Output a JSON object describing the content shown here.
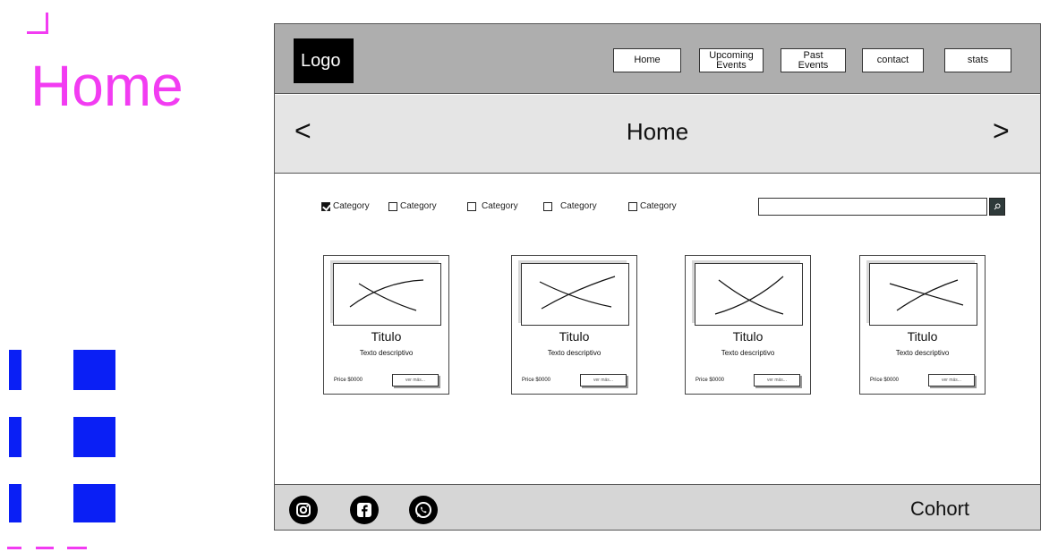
{
  "slide": {
    "title": "Home"
  },
  "colors": {
    "accent_pink": "#f23cf2",
    "accent_blue": "#0a1ff5",
    "header_gray": "#aeaeae",
    "hero_gray": "#e5e5e5",
    "footer_gray": "#d6d6d6"
  },
  "header": {
    "logo": "Logo",
    "nav": [
      {
        "label": "Home"
      },
      {
        "label": "Upcoming Events"
      },
      {
        "label": "Past Events"
      },
      {
        "label": "contact"
      },
      {
        "label": "stats"
      }
    ]
  },
  "hero": {
    "prev": "<",
    "title": "Home",
    "next": ">"
  },
  "filters": {
    "categories": [
      {
        "label": "Category",
        "checked": true
      },
      {
        "label": "Category",
        "checked": false
      },
      {
        "label": "Category",
        "checked": false
      },
      {
        "label": "Category",
        "checked": false
      },
      {
        "label": "Category",
        "checked": false
      }
    ],
    "search_value": "",
    "search_icon": "search-icon"
  },
  "cards": [
    {
      "title": "Titulo",
      "description": "Texto descriptivo",
      "price": "Price $0000",
      "button": "ver más..."
    },
    {
      "title": "Titulo",
      "description": "Texto descriptivo",
      "price": "Price $0000",
      "button": "ver más..."
    },
    {
      "title": "Titulo",
      "description": "Texto descriptivo",
      "price": "Price $0000",
      "button": "ver más..."
    },
    {
      "title": "Titulo",
      "description": "Texto descriptivo",
      "price": "Price $0000",
      "button": "ver más..."
    }
  ],
  "footer": {
    "icons": [
      "instagram-icon",
      "facebook-icon",
      "whatsapp-icon"
    ],
    "label": "Cohort"
  }
}
